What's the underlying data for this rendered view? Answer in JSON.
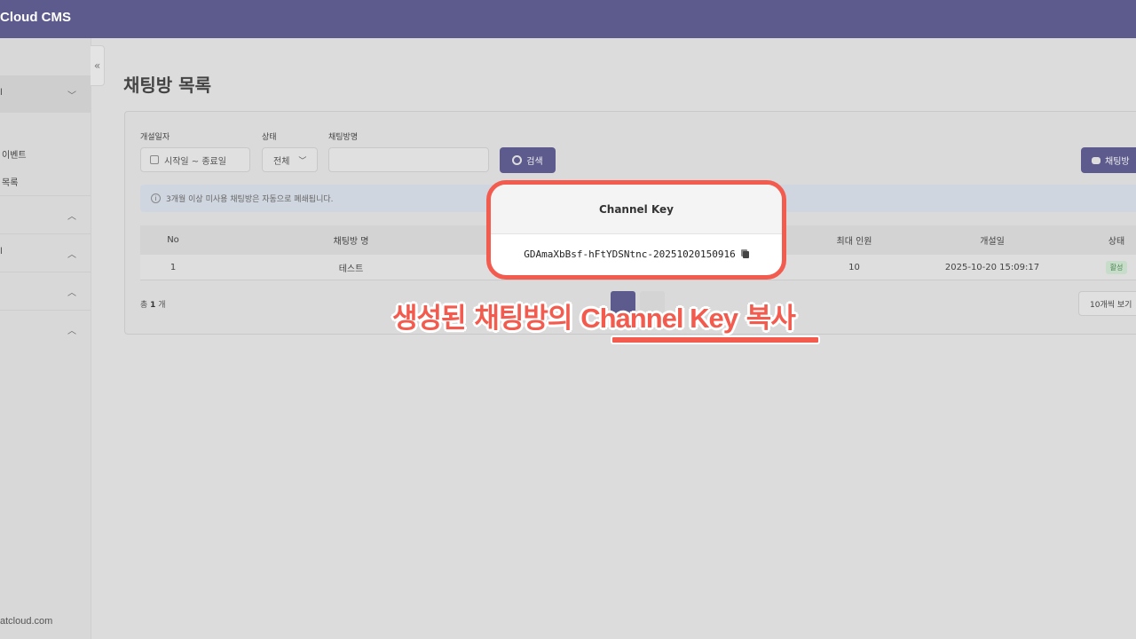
{
  "app": {
    "brand": "Cloud CMS"
  },
  "sidebar": {
    "items": [
      {
        "label": "l",
        "chevron": "﹀"
      },
      {
        "label": "이벤트"
      },
      {
        "label": "목록"
      },
      {
        "label": "",
        "chevron": "︿"
      },
      {
        "label": "l",
        "chevron": "︿"
      },
      {
        "label": "",
        "chevron": "︿"
      },
      {
        "label": "",
        "chevron": "︿"
      }
    ],
    "collapse_glyph": "«",
    "footer": "atcloud.com"
  },
  "page": {
    "title": "채팅방 목록"
  },
  "filters": {
    "date_label": "개설일자",
    "date_placeholder": "시작일 ~ 종료일",
    "status_label": "상태",
    "status_value": "전체",
    "name_label": "채팅방명",
    "name_value": "",
    "search_button": "검색",
    "create_button": "채팅방"
  },
  "notice": {
    "text": "3개월 이상 미사용 채팅방은 자동으로 폐쇄됩니다."
  },
  "table": {
    "headers": [
      "No",
      "채팅방 명",
      "최대 인원",
      "개설일",
      "상태"
    ],
    "rows": [
      {
        "no": "1",
        "name": "테스트",
        "max": "10",
        "created": "2025-10-20 15:09:17",
        "status": "활성"
      }
    ]
  },
  "pagination": {
    "total_prefix": "총",
    "total_count": "1",
    "total_suffix": "개",
    "page_size": "10개씩 보기"
  },
  "popup": {
    "title": "Channel Key",
    "key": "GDAmaXbBsf-hFtYDSNtnc-20251020150916"
  },
  "annotation": {
    "prefix": "생성된 채팅방의 ",
    "highlight": "Channel Key",
    "suffix": " 복사"
  },
  "colors": {
    "header": "#5d5a8d",
    "accent": "#f25b4e",
    "badge_active": "#4d8a55"
  }
}
